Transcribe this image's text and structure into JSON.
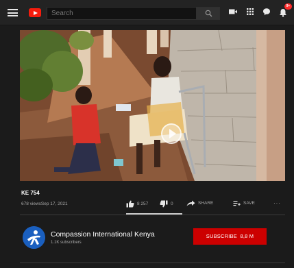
{
  "header": {
    "search": {
      "placeholder": "Search"
    },
    "notification_count": "9+"
  },
  "video": {
    "title": "KE 754",
    "views": "678 views",
    "date": "Sep 17, 2021",
    "likes": "8 257",
    "dislikes": "0",
    "share_label": "SHARE",
    "save_label": "SAVE",
    "more_label": "···",
    "like_ratio": 1.0
  },
  "channel": {
    "name": "Compassion International Kenya",
    "subscribers": "1.1K subscribers",
    "subscribe_label": "SUBSCRIBE",
    "subscribe_count": "8,8 M"
  },
  "colors": {
    "brand_red": "#cc0000",
    "background": "#1b1b1b",
    "topbar": "#232323"
  }
}
